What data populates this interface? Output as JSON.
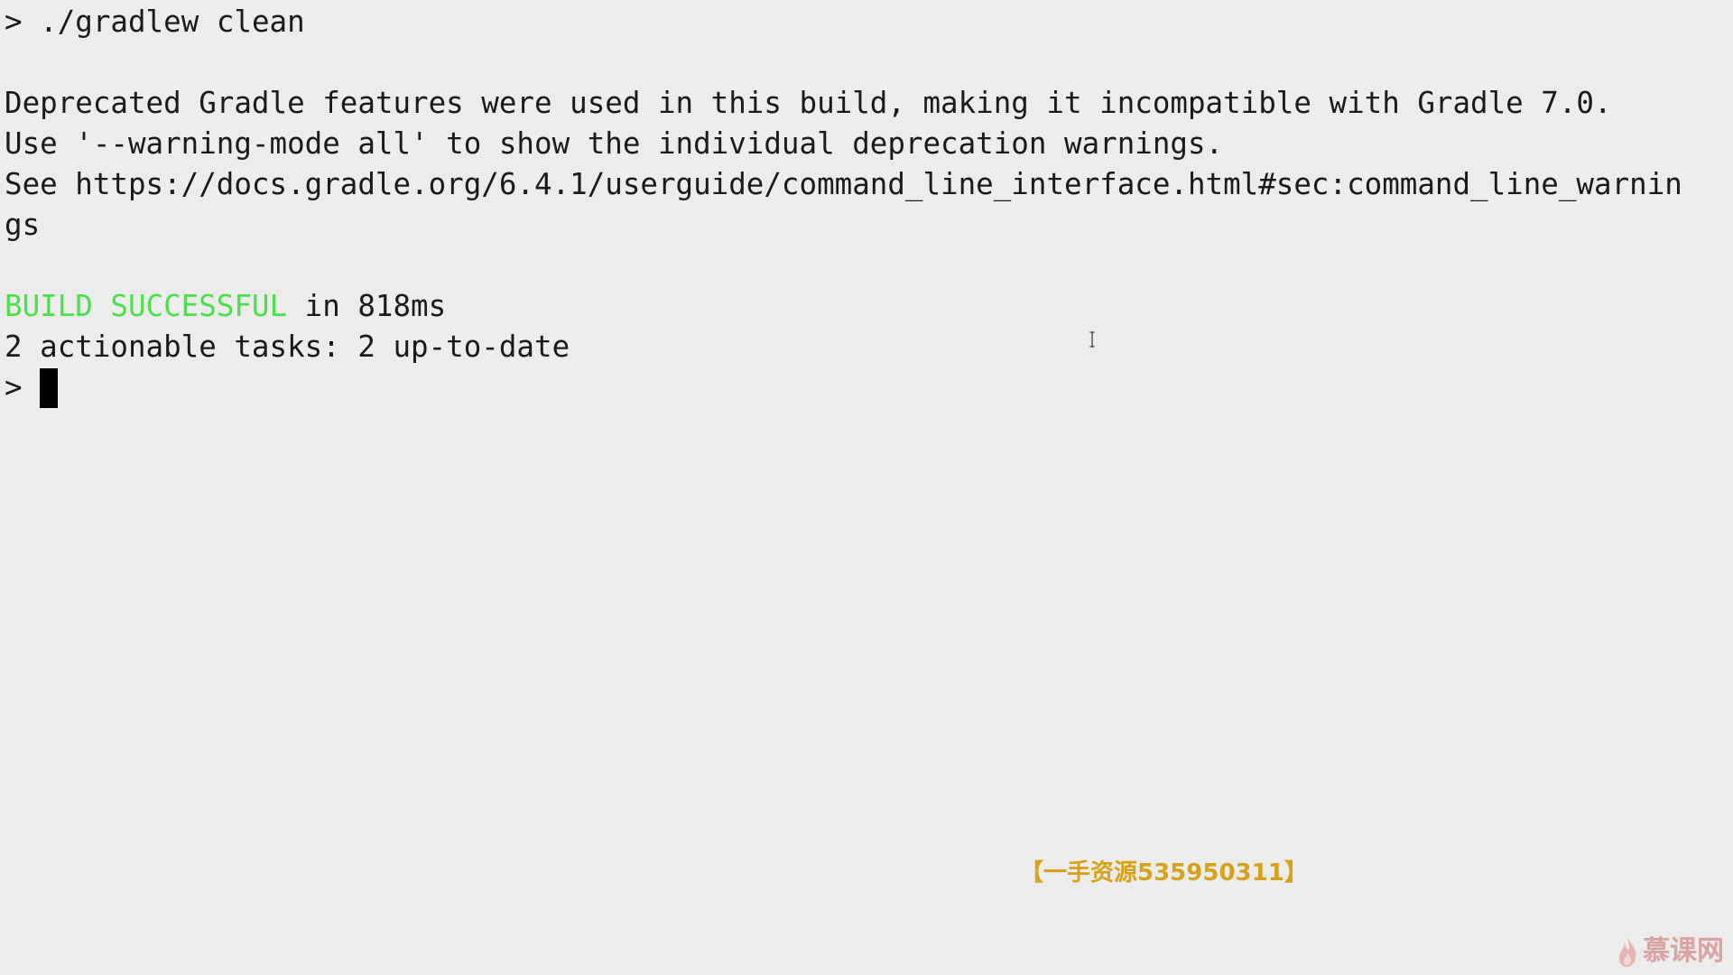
{
  "terminal": {
    "prompt_symbol": ">",
    "command": "./gradlew clean",
    "output": {
      "warning_line_1": "Deprecated Gradle features were used in this build, making it incompatible with Gradle 7.0.",
      "warning_line_2": "Use '--warning-mode all' to show the individual deprecation warnings.",
      "warning_line_3": "See https://docs.gradle.org/6.4.1/userguide/command_line_interface.html#sec:command_line_warnin",
      "warning_line_4": "gs",
      "build_status": "BUILD SUCCESSFUL",
      "build_time": " in 818ms",
      "tasks_summary": "2 actionable tasks: 2 up-to-date"
    },
    "next_prompt_symbol": ">"
  },
  "overlay": {
    "watermark_text": "【一手资源535950311】",
    "logo_text": "慕课网",
    "watermark_color": "#d6a21c",
    "success_color": "#4be04b",
    "logo_color": "#d9a3a3"
  }
}
